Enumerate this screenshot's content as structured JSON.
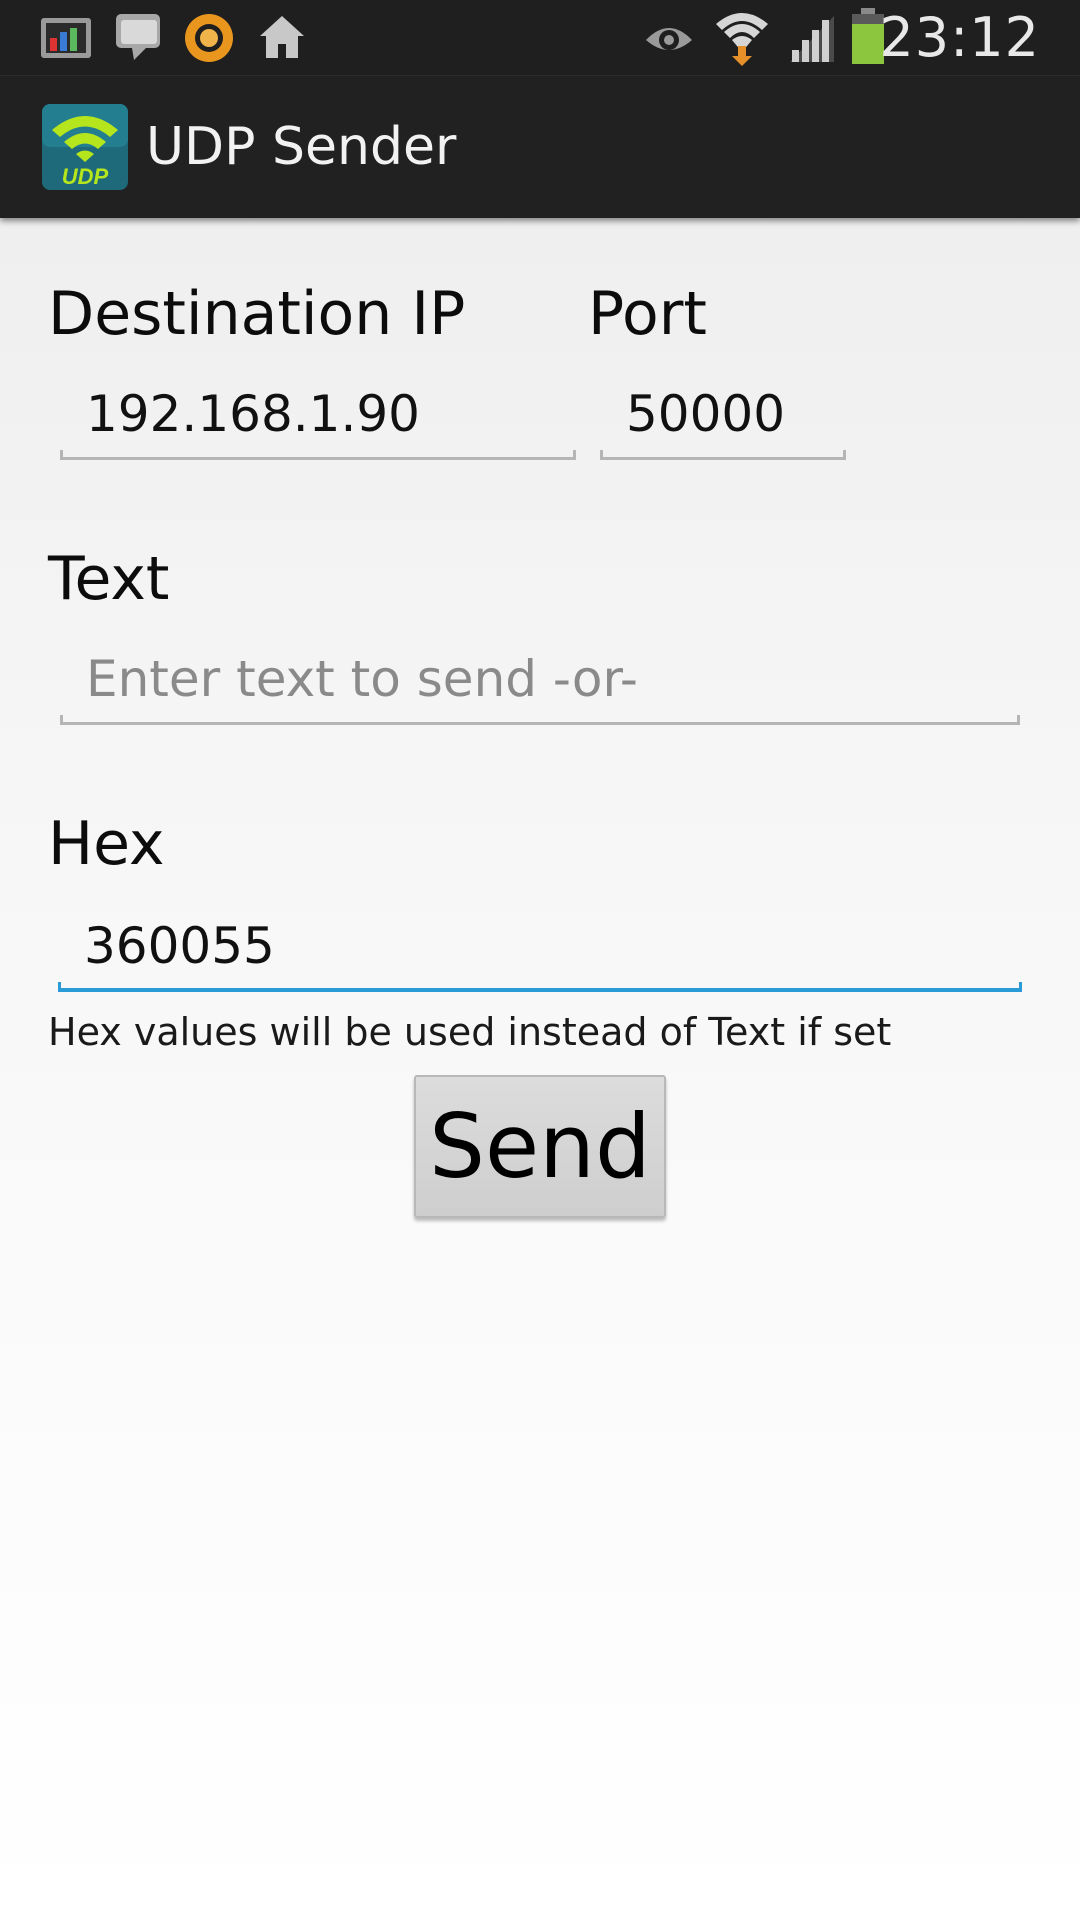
{
  "status_bar": {
    "time": "23:12",
    "left_icons": [
      "gallery-icon",
      "chat-icon",
      "app-circle-icon",
      "home-icon"
    ],
    "right_icons": [
      "eye-icon",
      "wifi-icon",
      "signal-icon",
      "battery-icon"
    ],
    "colors": {
      "background": "#1f1f1f",
      "battery": "#8cc63f",
      "data_arrow": "#e6902a"
    }
  },
  "app_bar": {
    "title": "UDP Sender",
    "logo_text": "UDP",
    "colors": {
      "background": "#212121",
      "logo_bg": "#1e6a7a",
      "logo_accent": "#b5e61d"
    }
  },
  "form": {
    "ip_label": "Destination IP",
    "ip_value": "192.168.1.90",
    "port_label": "Port",
    "port_value": "50000",
    "text_label": "Text",
    "text_placeholder": "Enter text to send -or-",
    "hex_label": "Hex",
    "hex_value": "360055",
    "hint": "Hex values will be used instead of Text if set",
    "focus_color": "#2a9bd6"
  },
  "send_button": {
    "label": "Send"
  }
}
